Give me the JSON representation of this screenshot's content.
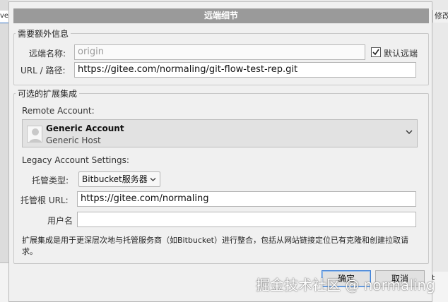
{
  "background": {
    "left_tab_label": "ve",
    "right_tab_label": "修改的",
    "right_bottom_label": "t"
  },
  "dialog": {
    "title": "远端细节",
    "required_group": {
      "legend": "需要额外信息",
      "remote_name_label": "远端名称:",
      "remote_name_placeholder": "origin",
      "default_remote_label": "默认远端",
      "default_remote_checked": true,
      "url_label": "URL / 路径:",
      "url_value": "https://gitee.com/normaling/git-flow-test-rep.git"
    },
    "integration_group": {
      "legend": "可选的扩展集成",
      "remote_account_label": "Remote Account:",
      "account": {
        "name": "Generic Account",
        "host": "Generic Host"
      },
      "legacy_label": "Legacy Account Settings:",
      "hosting_type_label": "托管类型:",
      "hosting_type_value": "Bitbucket服务器",
      "host_root_label": "托管根 URL:",
      "host_root_value": "https://gitee.com/normaling",
      "username_label": "用户名",
      "username_value": "",
      "note": "扩展集成是用于更深层次地与托管服务商（如Bitbucket）进行整合，包括从网站链接定位已有克隆和创建拉取请求。"
    },
    "buttons": {
      "ok": "确定",
      "cancel": "取消"
    }
  },
  "watermark": "掘金技术社区 @ normaling"
}
